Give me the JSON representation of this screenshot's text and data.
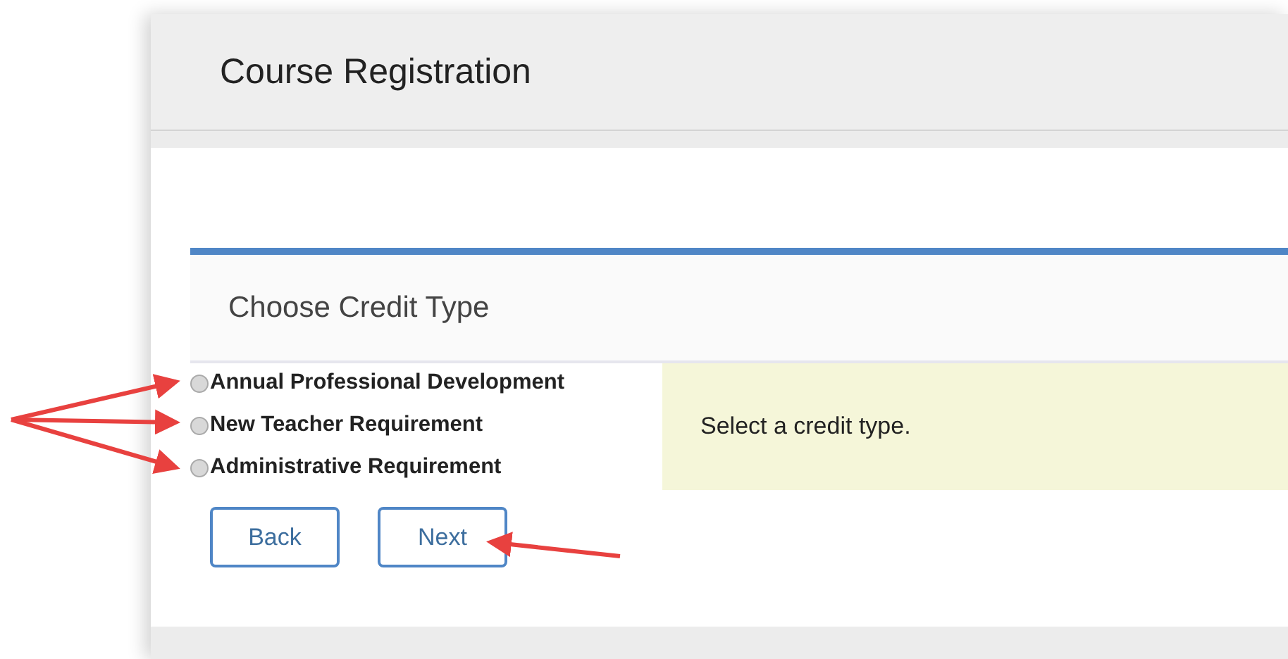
{
  "header": {
    "title": "Course Registration"
  },
  "panel": {
    "title": "Choose Credit Type",
    "options": [
      {
        "label": "Annual Professional Development",
        "selected": false
      },
      {
        "label": "New Teacher Requirement",
        "selected": false
      },
      {
        "label": "Administrative Requirement",
        "selected": false
      }
    ],
    "message": "Select a credit type."
  },
  "buttons": [
    "Back",
    "Next"
  ]
}
